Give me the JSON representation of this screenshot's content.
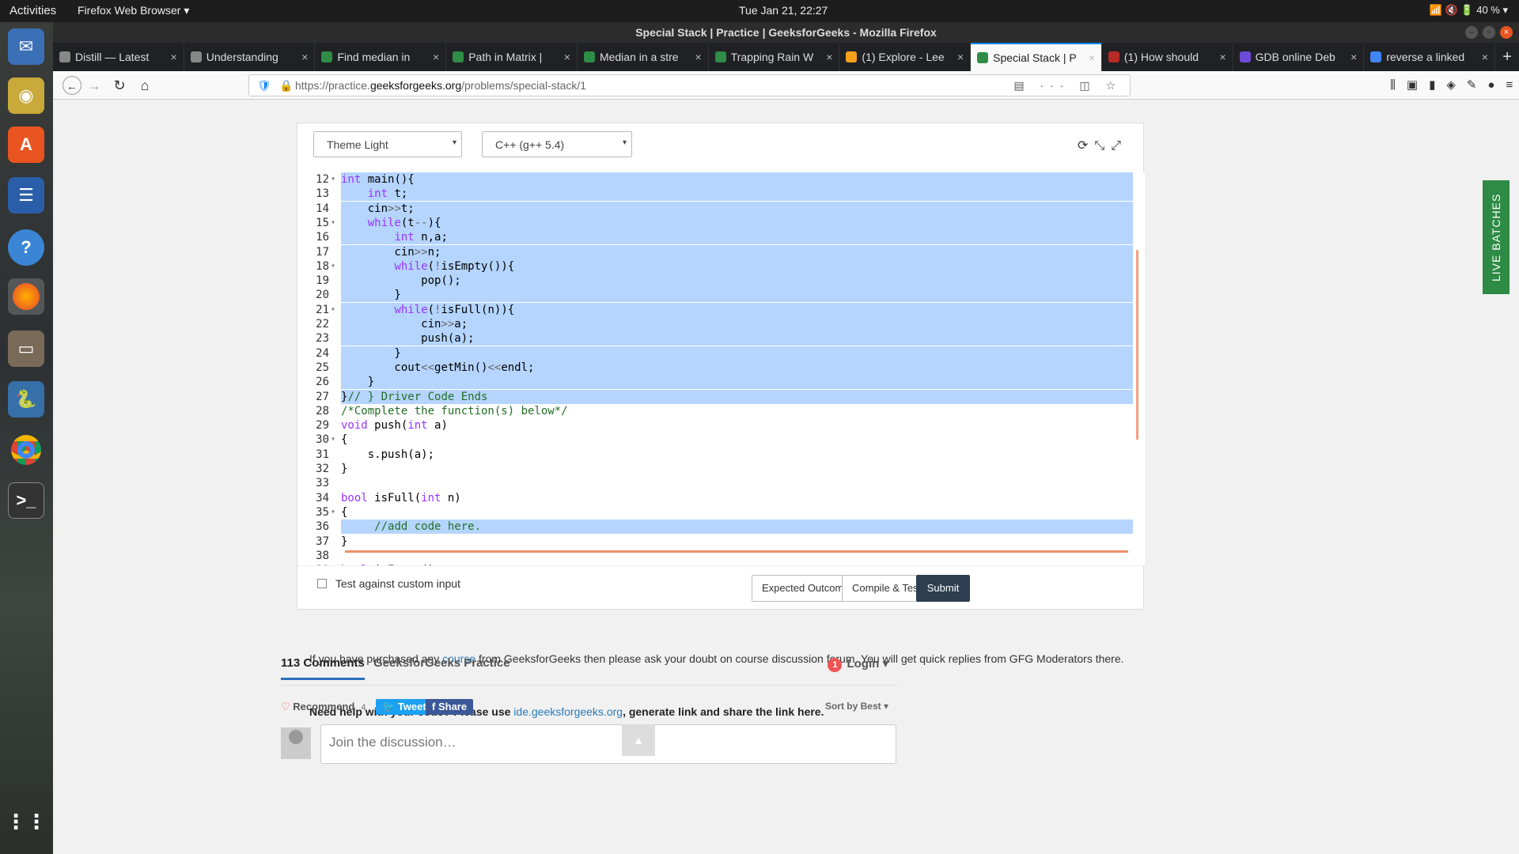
{
  "topbar": {
    "activities": "Activities",
    "app": "Firefox Web Browser ▾",
    "clock": "Tue Jan 21, 22:27",
    "battery": "40 %"
  },
  "window_title": "Special Stack | Practice | GeeksforGeeks - Mozilla Firefox",
  "tabs": [
    {
      "label": "Distill — Latest"
    },
    {
      "label": "Understanding"
    },
    {
      "label": "Find median in"
    },
    {
      "label": "Path in Matrix |"
    },
    {
      "label": "Median in a stre"
    },
    {
      "label": "Trapping Rain W"
    },
    {
      "label": "(1) Explore - Lee"
    },
    {
      "label": "Special Stack | P"
    },
    {
      "label": "(1) How should"
    },
    {
      "label": "GDB online Deb"
    },
    {
      "label": "reverse a linked"
    }
  ],
  "url": {
    "prefix": "https://practice.",
    "domain": "geeksforgeeks.org",
    "path": "/problems/special-stack/1"
  },
  "editor": {
    "theme": "Theme Light",
    "language": "C++ (g++ 5.4)",
    "lines": [
      {
        "n": "12",
        "f": "▾",
        "hl": true,
        "html": "<span class=\"kw\">int</span> main(){"
      },
      {
        "n": "13",
        "f": "",
        "hl": true,
        "html": "    <span class=\"kw\">int</span> t;"
      },
      {
        "n": "14",
        "f": "",
        "hl": true,
        "html": "    cin<span class=\"op\">&gt;&gt;</span>t;"
      },
      {
        "n": "15",
        "f": "▾",
        "hl": true,
        "html": "    <span class=\"kw\">while</span>(t<span class=\"op\">--</span>){"
      },
      {
        "n": "16",
        "f": "",
        "hl": true,
        "html": "        <span class=\"kw\">int</span> n,a;"
      },
      {
        "n": "17",
        "f": "",
        "hl": true,
        "html": "        cin<span class=\"op\">&gt;&gt;</span>n;"
      },
      {
        "n": "18",
        "f": "▾",
        "hl": true,
        "html": "        <span class=\"kw\">while</span>(<span class=\"op\">!</span>isEmpty()){"
      },
      {
        "n": "19",
        "f": "",
        "hl": true,
        "html": "            pop();"
      },
      {
        "n": "20",
        "f": "",
        "hl": true,
        "html": "        }"
      },
      {
        "n": "21",
        "f": "▾",
        "hl": true,
        "html": "        <span class=\"kw\">while</span>(<span class=\"op\">!</span>isFull(n)){"
      },
      {
        "n": "22",
        "f": "",
        "hl": true,
        "html": "            cin<span class=\"op\">&gt;&gt;</span>a;"
      },
      {
        "n": "23",
        "f": "",
        "hl": true,
        "html": "            push(a);"
      },
      {
        "n": "24",
        "f": "",
        "hl": true,
        "html": "        }"
      },
      {
        "n": "25",
        "f": "",
        "hl": true,
        "html": "        cout<span class=\"op\">&lt;&lt;</span>getMin()<span class=\"op\">&lt;&lt;</span>endl;"
      },
      {
        "n": "26",
        "f": "",
        "hl": true,
        "html": "    }"
      },
      {
        "n": "27",
        "f": "",
        "hl": true,
        "html": "}<span class=\"cm\">// } Driver Code Ends</span>"
      },
      {
        "n": "28",
        "f": "",
        "hl": false,
        "html": "<span class=\"cm\">/*Complete the function(s) below*/</span>"
      },
      {
        "n": "29",
        "f": "",
        "hl": false,
        "html": "<span class=\"kw\">void</span> push(<span class=\"kw\">int</span> a)"
      },
      {
        "n": "30",
        "f": "▾",
        "hl": false,
        "html": "{"
      },
      {
        "n": "31",
        "f": "",
        "hl": false,
        "html": "    s.push(a);"
      },
      {
        "n": "32",
        "f": "",
        "hl": false,
        "html": "}"
      },
      {
        "n": "33",
        "f": "",
        "hl": false,
        "html": ""
      },
      {
        "n": "34",
        "f": "",
        "hl": false,
        "html": "<span class=\"kw\">bool</span> isFull(<span class=\"kw\">int</span> n)"
      },
      {
        "n": "35",
        "f": "▾",
        "hl": false,
        "html": "{"
      },
      {
        "n": "36",
        "f": "",
        "hl": true,
        "html": "     <span class=\"cm\">//add code here.</span>"
      },
      {
        "n": "37",
        "f": "",
        "hl": false,
        "html": "}"
      },
      {
        "n": "38",
        "f": "",
        "hl": false,
        "html": ""
      },
      {
        "n": "39",
        "f": "",
        "hl": false,
        "html": "<span class=\"kw\">bool</span> isEmpty()"
      }
    ]
  },
  "footer": {
    "custom_input_label": "Test against custom input",
    "expected_label": "Expected Outcome",
    "compile_label": "Compile & Test",
    "submit_label": "Submit"
  },
  "live_batches": "LIVE BATCHES",
  "notice": {
    "pre": "If you have purchased any ",
    "link": "course",
    "post": " from GeeksforGeeks then please ask your doubt on course discussion forum. You will get quick replies from GFG Moderators there."
  },
  "help": {
    "pre": "Need help with your code? Please use ",
    "link": "ide.geeksforgeeks.org",
    "post": ", generate link and share the link here."
  },
  "comments": {
    "count_tab": "113 Comments",
    "site_tab": "GeeksforGeeks Practice",
    "login_badge": "1",
    "login": "Login ▾",
    "recommend": "Recommend",
    "recommend_count": "4",
    "tweet": "Tweet",
    "share": "Share",
    "sort": "Sort by Best ▾",
    "placeholder": "Join the discussion…"
  },
  "colors": {
    "accent": "#0a84ff",
    "submit": "#2c3e50",
    "live": "#2e8b45",
    "selection": "#b5d5ff"
  }
}
